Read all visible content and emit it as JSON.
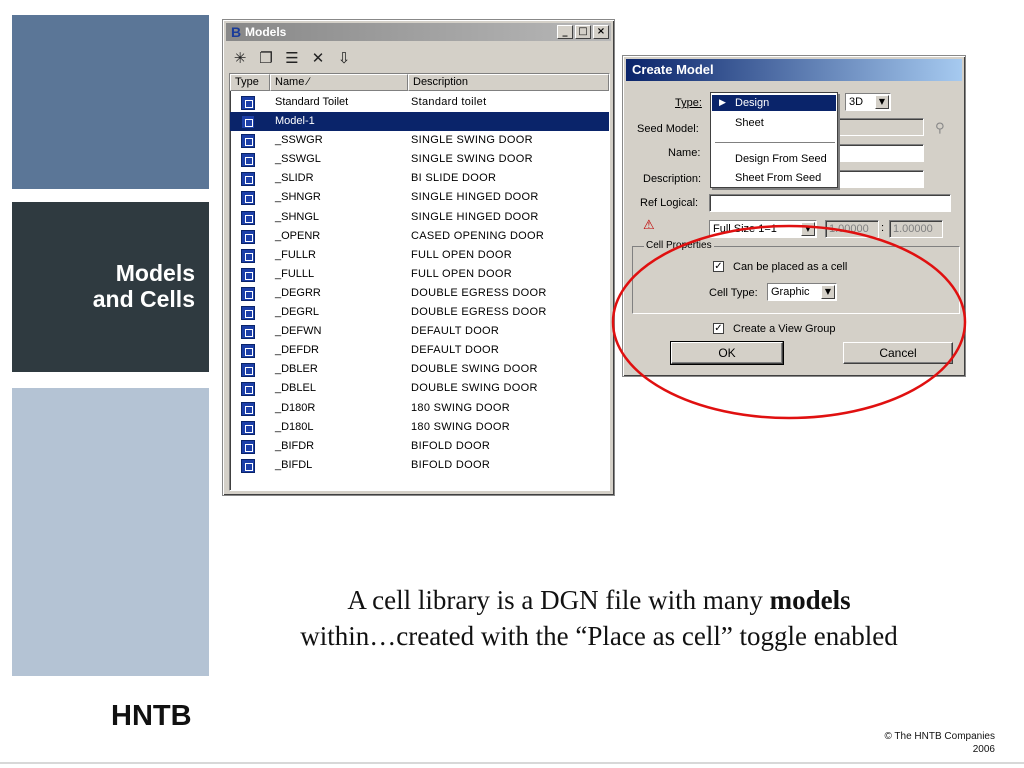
{
  "slide": {
    "title_line1": "Models",
    "title_line2": "and Cells",
    "caption_pre": "A cell library is a DGN file with many ",
    "caption_bold": "models",
    "caption_post": "within…created with the “Place as cell” toggle enabled",
    "logo": "HNTB",
    "copyright_line1": "© The HNTB Companies",
    "copyright_line2": "2006"
  },
  "models_window": {
    "title": "Models",
    "title_icon": "microstation-logo-icon",
    "window_buttons": [
      "_",
      "□",
      "×"
    ],
    "toolbar": [
      {
        "name": "new-model-icon",
        "glyph": "✳"
      },
      {
        "name": "copy-model-icon",
        "glyph": "❐"
      },
      {
        "name": "properties-icon",
        "glyph": "☰"
      },
      {
        "name": "delete-icon",
        "glyph": "✕"
      },
      {
        "name": "import-icon",
        "glyph": "⇩"
      }
    ],
    "columns": [
      "Type",
      "Name ∕",
      "Description"
    ],
    "rows": [
      {
        "name": "Standard Toilet",
        "description": "Standard toilet"
      },
      {
        "name": "Model-1",
        "description": "",
        "selected": true
      },
      {
        "name": "_SSWGR",
        "description": "SINGLE SWING DOOR"
      },
      {
        "name": "_SSWGL",
        "description": "SINGLE SWING DOOR"
      },
      {
        "name": "_SLIDR",
        "description": "BI SLIDE DOOR"
      },
      {
        "name": "_SHNGR",
        "description": "SINGLE HINGED DOOR"
      },
      {
        "name": "_SHNGL",
        "description": "SINGLE HINGED DOOR"
      },
      {
        "name": "_OPENR",
        "description": "CASED OPENING DOOR"
      },
      {
        "name": "_FULLR",
        "description": "FULL OPEN DOOR"
      },
      {
        "name": "_FULLL",
        "description": "FULL OPEN DOOR"
      },
      {
        "name": "_DEGRR",
        "description": "DOUBLE EGRESS DOOR"
      },
      {
        "name": "_DEGRL",
        "description": "DOUBLE EGRESS DOOR"
      },
      {
        "name": "_DEFWN",
        "description": "DEFAULT DOOR"
      },
      {
        "name": "_DEFDR",
        "description": "DEFAULT DOOR"
      },
      {
        "name": "_DBLER",
        "description": "DOUBLE SWING DOOR"
      },
      {
        "name": "_DBLEL",
        "description": "DOUBLE SWING DOOR"
      },
      {
        "name": "_D180R",
        "description": "180 SWING DOOR"
      },
      {
        "name": "_D180L",
        "description": "180 SWING DOOR"
      },
      {
        "name": "_BIFDR",
        "description": "BIFOLD DOOR"
      },
      {
        "name": "_BIFDL",
        "description": "BIFOLD DOOR"
      }
    ]
  },
  "create_model": {
    "title": "Create Model",
    "type_label": "Type:",
    "seed_label": "Seed Model:",
    "name_label": "Name:",
    "description_label": "Description:",
    "ref_logical_label": "Ref Logical:",
    "dimension_value": "3D",
    "type_menu": [
      "Design",
      "Sheet",
      "Design From Seed",
      "Sheet From Seed"
    ],
    "scale_value": "Full Size 1=1",
    "scale_num1": "1.00000",
    "scale_colon": ":",
    "scale_num2": "1.00000",
    "cell_properties_label": "Cell Properties",
    "can_be_placed_label": "Can be placed as a cell",
    "cell_type_label": "Cell Type:",
    "cell_type_value": "Graphic",
    "view_group_label": "Create a View Group",
    "ok_label": "OK",
    "cancel_label": "Cancel",
    "annotation_color": "#e01010"
  }
}
